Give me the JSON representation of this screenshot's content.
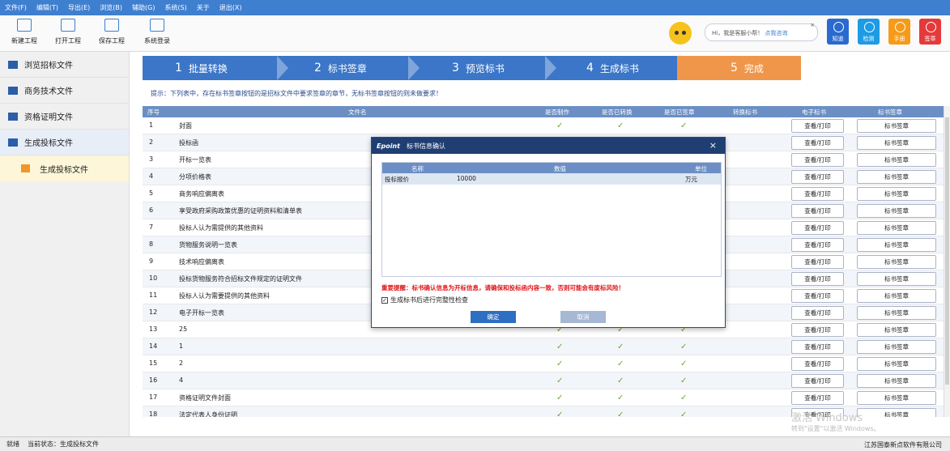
{
  "menu": [
    "文件(F)",
    "编辑(T)",
    "导出(E)",
    "浏览(B)",
    "辅助(G)",
    "系统(S)",
    "关于",
    "退出(X)"
  ],
  "toolbar": {
    "new": "新建工程",
    "open": "打开工程",
    "save": "保存工程",
    "login": "系统登录"
  },
  "assistant": {
    "greet": "Hi，我是客服小帮！",
    "link": "点我咨询",
    "close": "×"
  },
  "tiles": [
    {
      "label": "知道",
      "color": "#2a6ad0"
    },
    {
      "label": "检测",
      "color": "#1d9be4"
    },
    {
      "label": "手册",
      "color": "#f59b19"
    },
    {
      "label": "签章",
      "color": "#e43a3a"
    }
  ],
  "sidebar": {
    "items": [
      "浏览招标文件",
      "商务技术文件",
      "资格证明文件",
      "生成投标文件"
    ],
    "sub": "生成投标文件"
  },
  "steps": [
    {
      "num": "1",
      "label": "批量转换"
    },
    {
      "num": "2",
      "label": "标书签章"
    },
    {
      "num": "3",
      "label": "预览标书"
    },
    {
      "num": "4",
      "label": "生成标书"
    },
    {
      "num": "5",
      "label": "完成"
    }
  ],
  "tip": "提示：下列表中，存在标书签章按钮的是招标文件中要求签章的章节，无标书签章按钮的则未做要求！",
  "grid": {
    "headers": [
      "序号",
      "文件名",
      "是否制作",
      "是否已转换",
      "是否已签章",
      "转换标书",
      "电子标书",
      "标书签章"
    ],
    "view_btn": "查看/打印",
    "sign_btn": "标书签章",
    "check": "✓",
    "rows": [
      {
        "n": "1",
        "name": "封面",
        "c": true
      },
      {
        "n": "2",
        "name": "投标函",
        "c": false
      },
      {
        "n": "3",
        "name": "开标一览表",
        "c": false
      },
      {
        "n": "4",
        "name": "分项价格表",
        "c": false
      },
      {
        "n": "5",
        "name": "商务响应偏离表",
        "c": false
      },
      {
        "n": "6",
        "name": "享受政府采购政策优惠的证明资料和清单表",
        "c": false
      },
      {
        "n": "7",
        "name": "投标人认为需提供的其他资料",
        "c": false
      },
      {
        "n": "8",
        "name": "货物服务说明一览表",
        "c": false
      },
      {
        "n": "9",
        "name": "技术响应偏离表",
        "c": false
      },
      {
        "n": "10",
        "name": "投标货物服务符合招标文件规定的证明文件",
        "c": false
      },
      {
        "n": "11",
        "name": "投标人认为需要提供的其他资料",
        "c": false
      },
      {
        "n": "12",
        "name": "电子开标一览表",
        "c": false
      },
      {
        "n": "13",
        "name": "25",
        "c": true
      },
      {
        "n": "14",
        "name": "1",
        "c": true
      },
      {
        "n": "15",
        "name": "2",
        "c": true
      },
      {
        "n": "16",
        "name": "4",
        "c": true
      },
      {
        "n": "17",
        "name": "资格证明文件封面",
        "c": true
      },
      {
        "n": "18",
        "name": "法定代表人身份证明",
        "c": true
      }
    ]
  },
  "dialog": {
    "logo": "Epoint",
    "title": "标书信息确认",
    "close": "×",
    "headers": [
      "名称",
      "数值",
      "单位"
    ],
    "row": {
      "name": "投标报价",
      "value": "10000",
      "unit": "万元"
    },
    "warning": "重要提醒：标书确认信息为开标信息，请确保和投标函内容一致，否则可能会有废标风险！",
    "check_label": "生成标书后进行完整性检查",
    "ok": "确定",
    "cancel": "取消"
  },
  "watermark": {
    "line1": "激活 Windows",
    "line2": "转到\"设置\"以激活 Windows。"
  },
  "status": {
    "left": "就绪",
    "state": "当前状态：生成投标文件",
    "right": "江苏国泰新点软件有限公司"
  }
}
